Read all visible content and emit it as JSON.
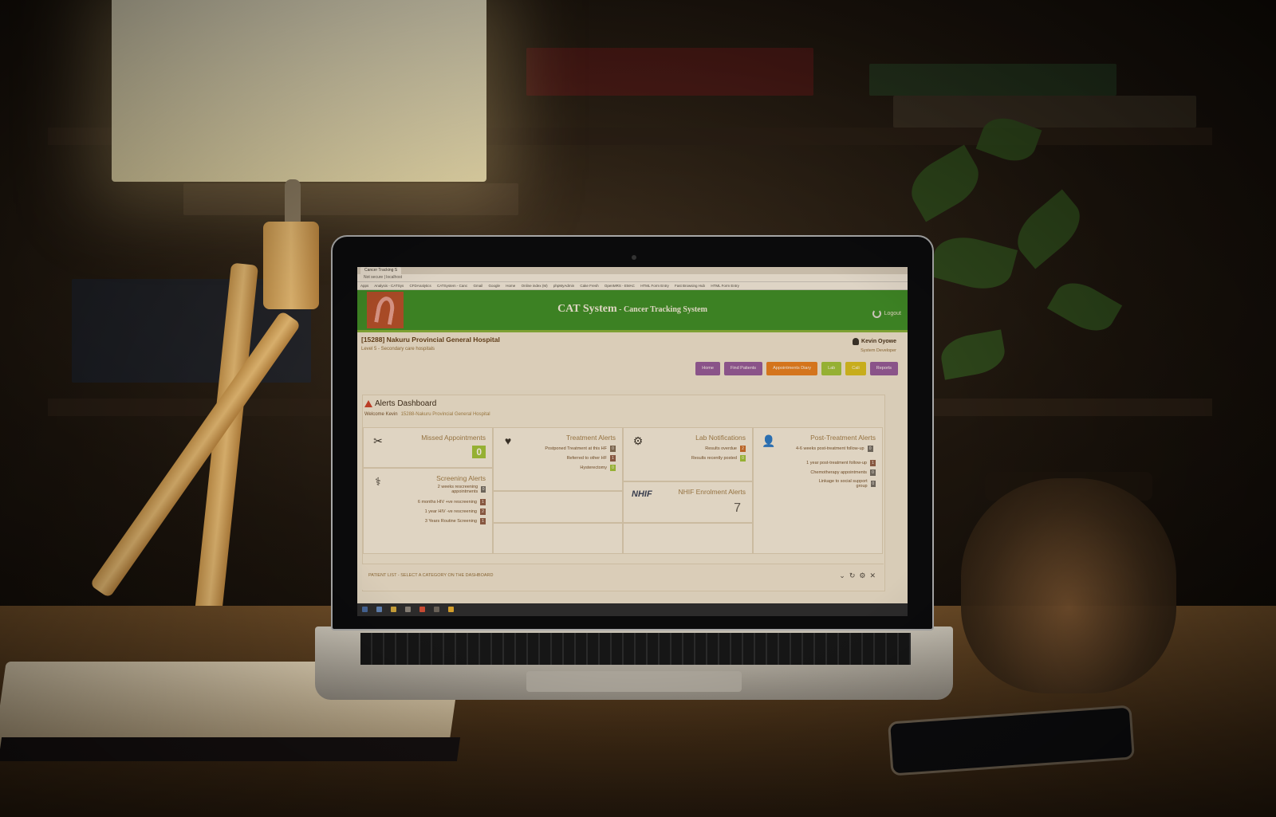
{
  "browser": {
    "tab_title": "Cancer Tracking S",
    "url": "Not secure | localhost",
    "bookmarks": [
      "Apps",
      "Analysis - CATSys",
      "CFDAnalytics",
      "CATSystem - Canc",
      "Gmail",
      "Google",
      "Home",
      "Online index (M)",
      "phpMyAdmin",
      "Cake Fresh",
      "OpenMRS - EMAC",
      "HTML Form Entry",
      "Fast Browsing Hub",
      "HTML Form Entry"
    ]
  },
  "header": {
    "title": "CAT System",
    "subtitle": " - Cancer Tracking System",
    "logout_label": "Logout"
  },
  "facility": {
    "name": "[15288] Nakuru Provincial General Hospital",
    "level": "Level 5 - Secondary care hospitals"
  },
  "user": {
    "name": "Kevin Oyowe",
    "role": "System Developer"
  },
  "nav": [
    {
      "label": "Home",
      "color": "#8e55a3"
    },
    {
      "label": "Find Patients",
      "color": "#8e55a3"
    },
    {
      "label": "Appointments Diary",
      "color": "#e87d1e"
    },
    {
      "label": "Lab",
      "color": "#9bc63a"
    },
    {
      "label": "Cali",
      "color": "#d8c21e"
    },
    {
      "label": "Reports",
      "color": "#8e55a3"
    }
  ],
  "dashboard": {
    "title": "Alerts Dashboard",
    "welcome": "Welcome Kevin",
    "location": "15288-Nakuru Provincial General Hospital"
  },
  "cards": {
    "missed": {
      "title": "Missed Appointments",
      "count": "0"
    },
    "treatment": {
      "title": "Treatment Alerts",
      "rows": [
        {
          "label": "Postponed Treatment at this HF",
          "count": "0"
        },
        {
          "label": "Referred to other HF",
          "count": "1"
        },
        {
          "label": "Hysterectomy",
          "count": "0"
        }
      ]
    },
    "lab": {
      "title": "Lab Notifications",
      "rows": [
        {
          "label": "Results overdue",
          "count": "2"
        },
        {
          "label": "Results recently posted",
          "count": "0"
        }
      ]
    },
    "post_treatment": {
      "title": "Post-Treatment Alerts",
      "rows": [
        {
          "label": "4-6 weeks post-treatment follow-up",
          "count": "0"
        },
        {
          "label": "1 year post-treatment follow-up",
          "count": "1"
        },
        {
          "label": "Chemotherapy appointments",
          "count": "0"
        },
        {
          "label": "Linkage to social support group",
          "count": "0"
        }
      ]
    },
    "screening": {
      "title": "Screening Alerts",
      "rows": [
        {
          "label": "2 weeks rescreening appointments",
          "count": "0"
        },
        {
          "label": "6 months HIV +ve rescreening",
          "count": "1"
        },
        {
          "label": "1 year HIV -ve rescreening",
          "count": "2"
        },
        {
          "label": "3 Years Routine Screening",
          "count": "1"
        }
      ]
    },
    "nhif": {
      "logo": "NHIF",
      "title": "NHIF Enrolment Alerts",
      "count": "7"
    }
  },
  "patients": {
    "title": "PATIENT LIST - SELECT A CATEGORY ON THE DASHBOARD"
  },
  "icons": {
    "missed": "scissors-icon",
    "treatment": "heartbeat-icon",
    "lab": "flask-gear-icon",
    "post_treatment": "user-clock-icon",
    "screening": "doctor-icon"
  }
}
